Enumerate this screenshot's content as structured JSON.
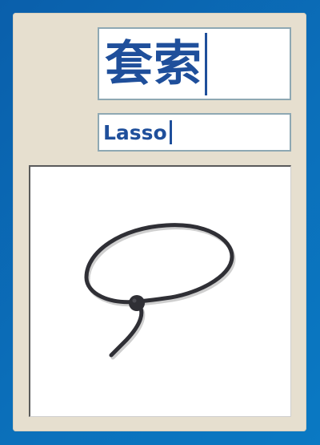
{
  "card": {
    "word_native": "套索",
    "word_english": "Lasso",
    "drawing_icon": "lasso-icon"
  },
  "colors": {
    "background": "#0b6fba",
    "panel": "#e6dfcf",
    "field_border": "#8ea8b3",
    "text": "#1f4f9b",
    "drawing_stroke": "#2f2f35"
  }
}
